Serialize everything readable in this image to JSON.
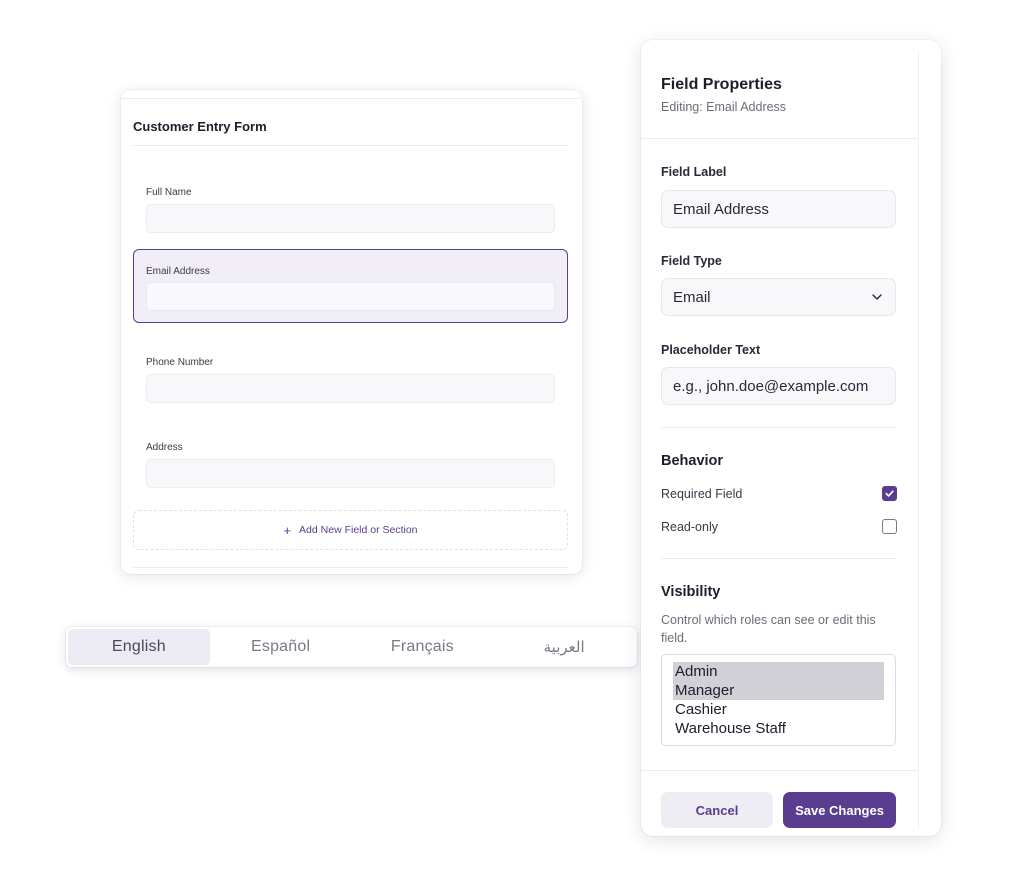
{
  "form": {
    "title": "Customer Entry Form",
    "fields": [
      {
        "label": "Full Name",
        "value": "",
        "selected": false
      },
      {
        "label": "Email Address",
        "value": "",
        "selected": true
      },
      {
        "label": "Phone Number",
        "value": "",
        "selected": false
      },
      {
        "label": "Address",
        "value": "",
        "selected": false
      }
    ],
    "add_field_label": "Add New Field or Section",
    "add_icon": "plus-icon"
  },
  "languages": {
    "items": [
      "English",
      "Español",
      "Français",
      "العربية"
    ],
    "active": "English"
  },
  "panel": {
    "title": "Field Properties",
    "subtitle": "Editing: Email Address",
    "field_label": {
      "label": "Field Label",
      "value": "Email Address"
    },
    "field_type": {
      "label": "Field Type",
      "value": "Email",
      "icon": "chevron-down-icon"
    },
    "placeholder": {
      "label": "Placeholder Text",
      "value": "e.g., john.doe@example.com"
    },
    "behavior": {
      "heading": "Behavior",
      "options": [
        {
          "label": "Required Field",
          "checked": true
        },
        {
          "label": "Read-only",
          "checked": false
        }
      ]
    },
    "visibility": {
      "heading": "Visibility",
      "description": "Control which roles can see or edit this field.",
      "roles": [
        {
          "label": "Admin",
          "selected": true
        },
        {
          "label": "Manager",
          "selected": true
        },
        {
          "label": "Cashier",
          "selected": false
        },
        {
          "label": "Warehouse Staff",
          "selected": false
        }
      ]
    },
    "cancel_label": "Cancel",
    "save_label": "Save Changes"
  },
  "colors": {
    "accent": "#5a3d8f",
    "selected_field_bg": "#f1eef7",
    "text": "#1f1d2b"
  }
}
